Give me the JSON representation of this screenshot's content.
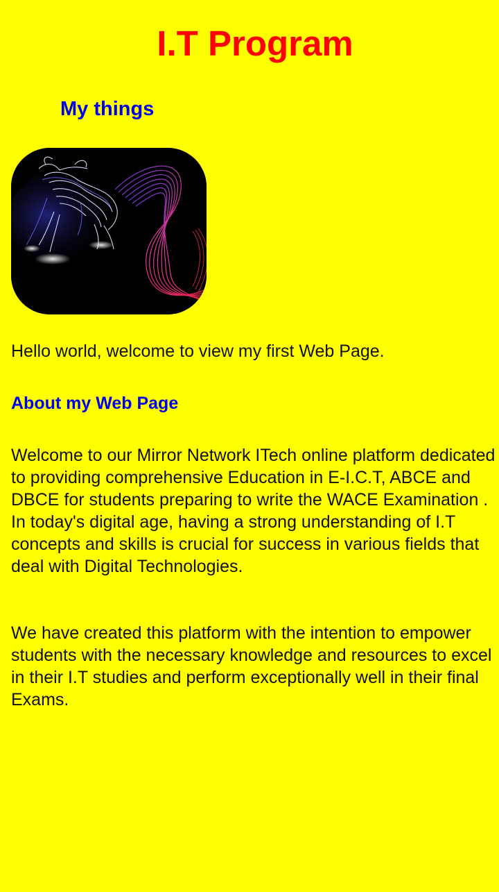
{
  "page": {
    "title": "I.T Program",
    "background_color": "#ffff00",
    "title_color": "#ff0000",
    "heading_color": "#0000ee"
  },
  "section": {
    "heading": "My things"
  },
  "image": {
    "description_icon": "glowing-bull-image"
  },
  "intro": {
    "text": "Hello world, welcome to view my first Web Page."
  },
  "about": {
    "heading": "About my Web Page",
    "paragraph_1": "Welcome to our Mirror Network ITech online platform dedicated to providing comprehensive Education in E-I.C.T, ABCE and DBCE for students preparing to write the WACE Examination . In today's digital age, having a strong understanding of I.T concepts and skills is crucial for success in various fields that deal with Digital Technologies.",
    "paragraph_2": "We have created this platform with the intention to empower students with the necessary knowledge and resources to excel in their I.T studies and perform exceptionally well in their final Exams."
  }
}
